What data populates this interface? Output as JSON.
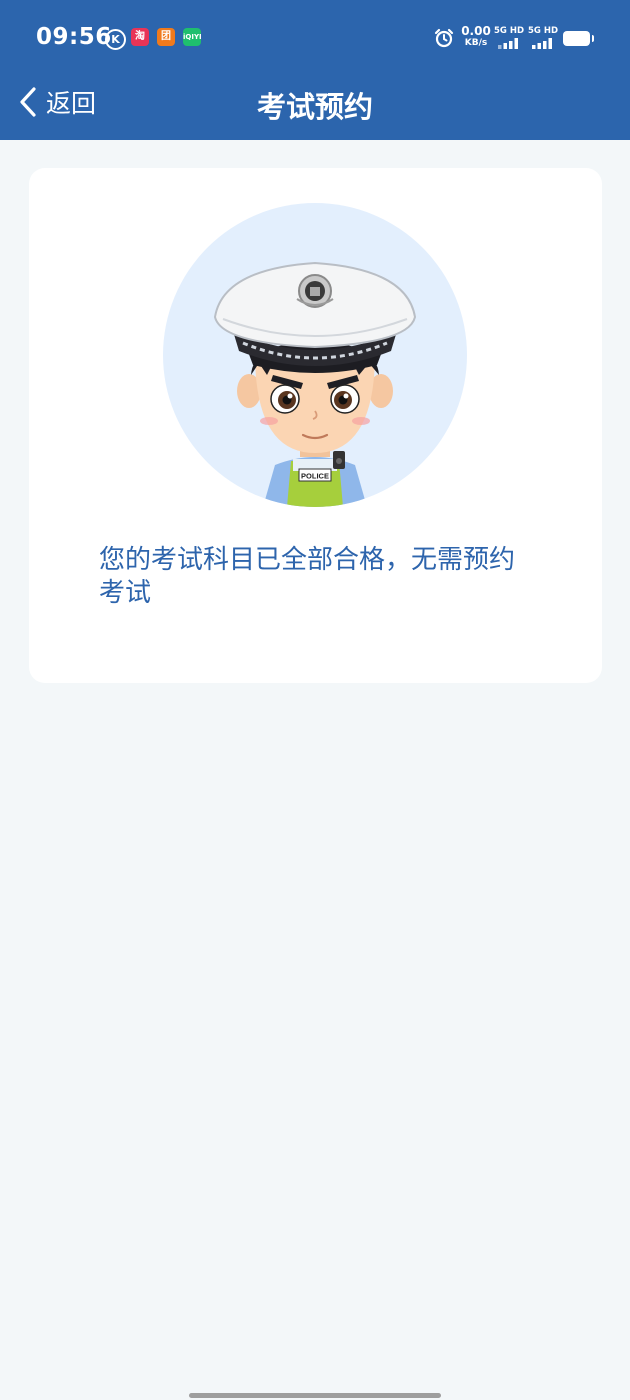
{
  "status_bar": {
    "time": "09:56",
    "app_icons": [
      "k-icon",
      "taobao-icon",
      "shopping-icon",
      "iqiyi-icon"
    ],
    "app_icon_labels": [
      "K",
      "淘",
      "团",
      "iQIYI"
    ],
    "net_speed_value": "0.00",
    "net_speed_unit": "KB/s",
    "signal_1_label": "5G HD",
    "signal_2_label": "5G HD"
  },
  "header": {
    "back_label": "返回",
    "title": "考试预约"
  },
  "card": {
    "illustration": {
      "name": "police-officer-avatar",
      "badge_text": "POLICE"
    },
    "message": "您的考试科目已全部合格，无需预约考试"
  },
  "colors": {
    "header_bg": "#2c65ad",
    "page_bg": "#f3f7f9",
    "card_bg": "#ffffff",
    "message_text": "#2d64ac",
    "avatar_circle_bg": "#e3effd"
  }
}
